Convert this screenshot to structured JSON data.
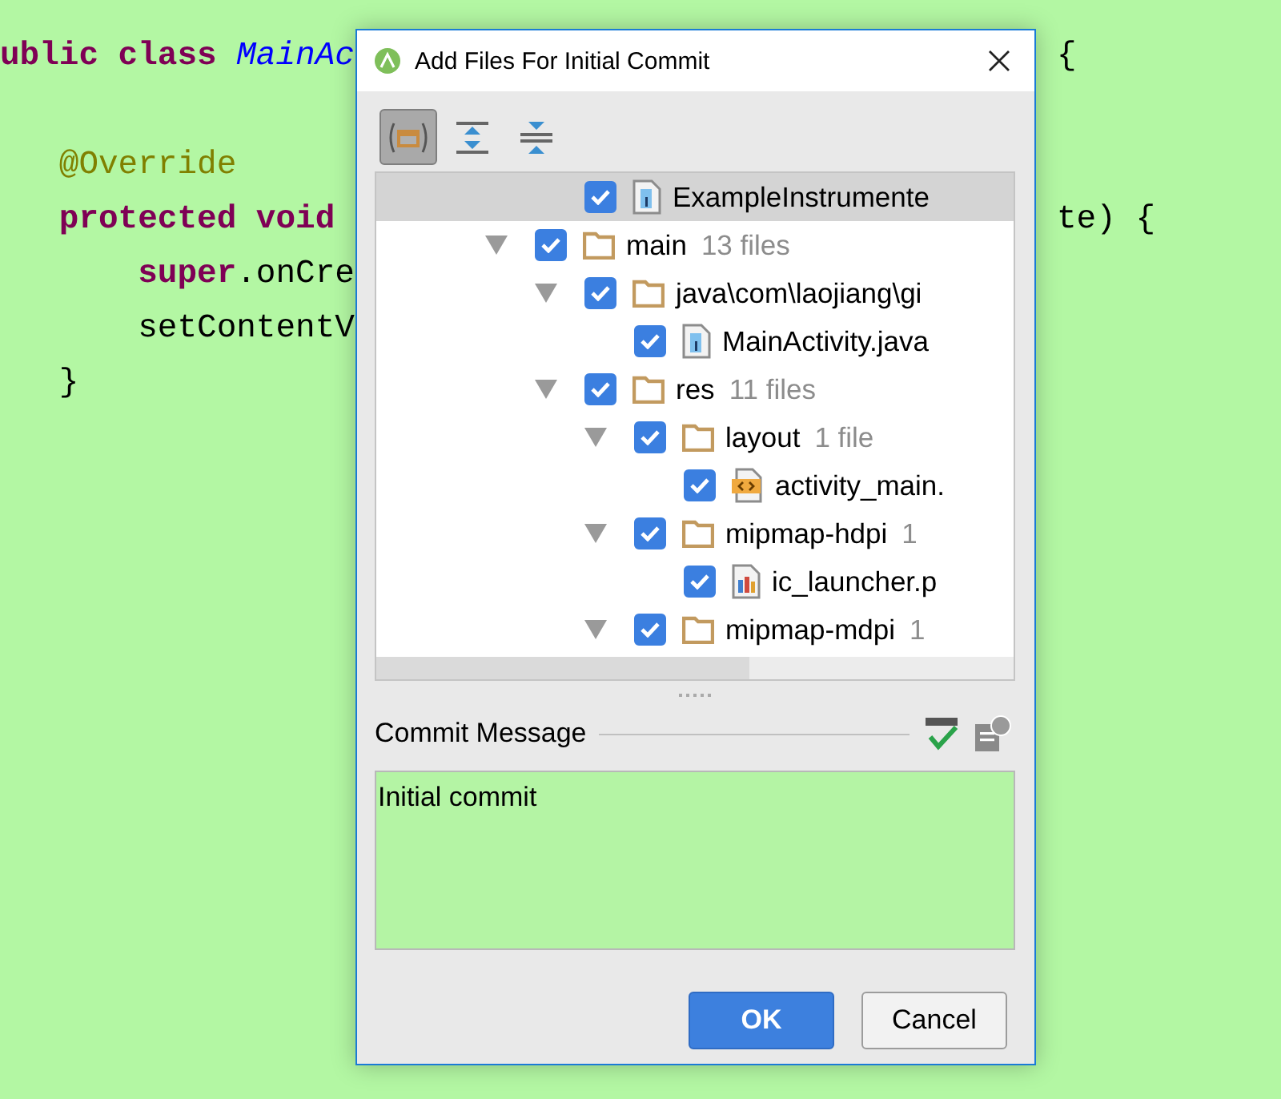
{
  "editor": {
    "lines": [
      {
        "tokens": [
          {
            "kind": "keyword",
            "text": "ublic class "
          },
          {
            "kind": "classname",
            "text": "MainAc"
          }
        ],
        "tail": "{"
      },
      {
        "tokens": [
          {
            "kind": "annotation",
            "text": "   @Override"
          }
        ]
      },
      {
        "tokens": [
          {
            "kind": "keyword",
            "text": "   protected void"
          }
        ],
        "tail": "te) {"
      },
      {
        "tokens": [
          {
            "kind": "keyword",
            "text": "       super"
          },
          {
            "kind": "plain",
            "text": ".onCre"
          }
        ]
      },
      {
        "tokens": [
          {
            "kind": "plain",
            "text": "       setContentV"
          }
        ]
      },
      {
        "tokens": [
          {
            "kind": "plain",
            "text": "   }"
          }
        ]
      }
    ]
  },
  "dialog": {
    "title": "Add Files For Initial Commit",
    "toolbar": [
      {
        "kind": "group",
        "selected": true
      },
      {
        "kind": "expand",
        "selected": false
      },
      {
        "kind": "collapse",
        "selected": false
      }
    ],
    "tree": {
      "items": [
        {
          "kind": "continued",
          "children": [
            {
              "kind": "java",
              "name": "ExampleInstrumente",
              "checked": true,
              "selected": true
            }
          ]
        },
        {
          "kind": "folder",
          "name": "main",
          "count": "13 files",
          "expanded": true,
          "checked": true,
          "selected": false,
          "children": [
            {
              "kind": "folder",
              "name": "java\\com\\laojiang\\gi",
              "expanded": true,
              "checked": true,
              "selected": false,
              "children": [
                {
                  "kind": "java",
                  "name": "MainActivity.java",
                  "checked": true,
                  "selected": false
                }
              ]
            },
            {
              "kind": "folder",
              "name": "res",
              "count": "11 files",
              "expanded": true,
              "checked": true,
              "selected": false,
              "children": [
                {
                  "kind": "folder",
                  "name": "layout",
                  "count": "1 file",
                  "expanded": true,
                  "checked": true,
                  "selected": false,
                  "children": [
                    {
                      "kind": "xml",
                      "name": "activity_main.",
                      "checked": true,
                      "selected": false
                    }
                  ]
                },
                {
                  "kind": "folder",
                  "name": "mipmap-hdpi",
                  "count": "1",
                  "expanded": true,
                  "checked": true,
                  "selected": false,
                  "children": [
                    {
                      "kind": "image",
                      "name": "ic_launcher.p",
                      "checked": true,
                      "selected": false
                    }
                  ]
                },
                {
                  "kind": "folder",
                  "name": "mipmap-mdpi",
                  "count": "1",
                  "expanded": true,
                  "checked": true,
                  "selected": false
                }
              ]
            }
          ]
        }
      ]
    },
    "commit_message": {
      "label": "Commit Message",
      "value": "Initial commit"
    },
    "buttons": [
      {
        "kind": "primary",
        "label": "OK"
      },
      {
        "kind": "secondary",
        "label": "Cancel"
      }
    ]
  }
}
